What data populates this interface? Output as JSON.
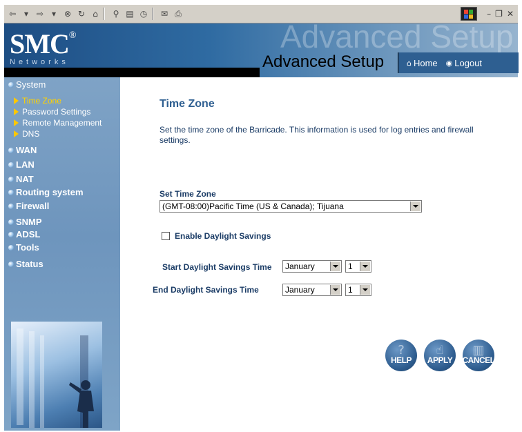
{
  "header": {
    "logo": "SMC",
    "logo_reg": "®",
    "networks": "Networks",
    "bg_text": "Advanced Setup",
    "advanced_setup": "Advanced Setup",
    "home": "Home",
    "logout": "Logout"
  },
  "sidebar": {
    "system": "System",
    "system_items": [
      "Time Zone",
      "Password Settings",
      "Remote Management",
      "DNS"
    ],
    "sections": [
      "WAN",
      "LAN",
      "NAT",
      "Routing system",
      "Firewall",
      "SNMP",
      "ADSL",
      "Tools",
      "Status"
    ]
  },
  "main": {
    "title": "Time Zone",
    "description": "Set the time zone of the Barricade.  This information is used for log entries and firewall settings.",
    "set_time_zone_label": "Set Time Zone",
    "time_zone_value": "(GMT-08:00)Pacific Time (US & Canada); Tijuana",
    "enable_dst_label": "Enable Daylight Savings",
    "start_dst_label": "Start Daylight Savings Time",
    "end_dst_label": "End Daylight Savings Time",
    "start_month": "January",
    "start_day": "1",
    "end_month": "January",
    "end_day": "1"
  },
  "buttons": {
    "help": "HELP",
    "apply": "APPLY",
    "cancel": "CANCEL"
  }
}
